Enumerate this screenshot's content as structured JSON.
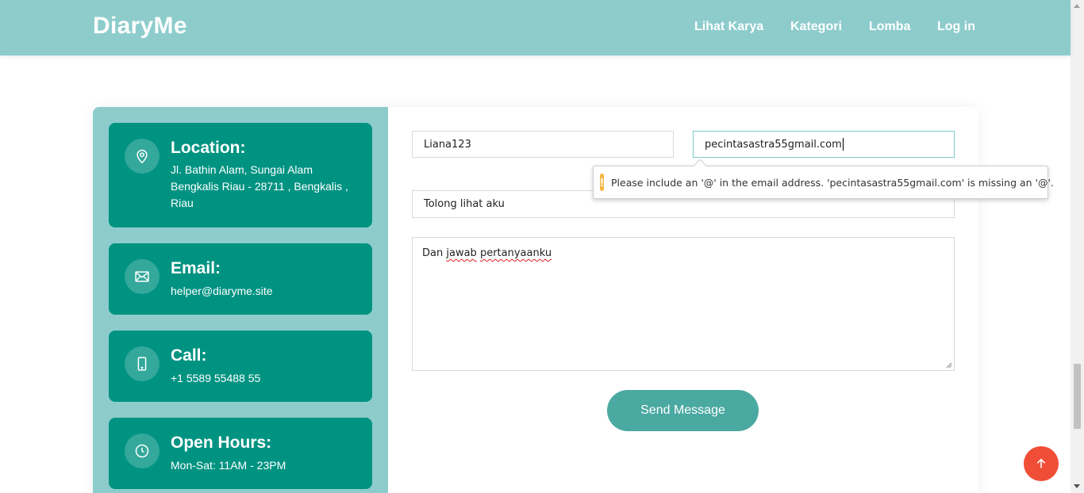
{
  "header": {
    "logo": "DiaryMe",
    "nav": [
      "Lihat Karya",
      "Kategori",
      "Lomba",
      "Log in"
    ]
  },
  "contact_info": [
    {
      "icon": "map-pin-icon",
      "title": "Location:",
      "text": "Jl. Bathin Alam, Sungai Alam Bengkalis Riau - 28711 , Bengkalis , Riau"
    },
    {
      "icon": "envelope-icon",
      "title": "Email:",
      "text": "helper@diaryme.site"
    },
    {
      "icon": "phone-icon",
      "title": "Call:",
      "text": "+1 5589 55488 55"
    },
    {
      "icon": "clock-icon",
      "title": "Open Hours:",
      "text": "Mon-Sat: 11AM - 23PM"
    }
  ],
  "form": {
    "name_value": "Liana123",
    "email_value": "pecintasastra55gmail.com",
    "subject_value": "Tolong lihat aku",
    "message_words": [
      "Dan",
      "jawab",
      "pertanyaanku"
    ],
    "send_label": "Send Message"
  },
  "validation": {
    "message": "Please include an '@' in the email address. 'pecintasastra55gmail.com' is missing an '@'."
  },
  "colors": {
    "header": "#8ecccc",
    "card": "#009382",
    "button": "#4aa9a1",
    "back_to_top": "#f04e37",
    "warning": "#f5b843"
  }
}
